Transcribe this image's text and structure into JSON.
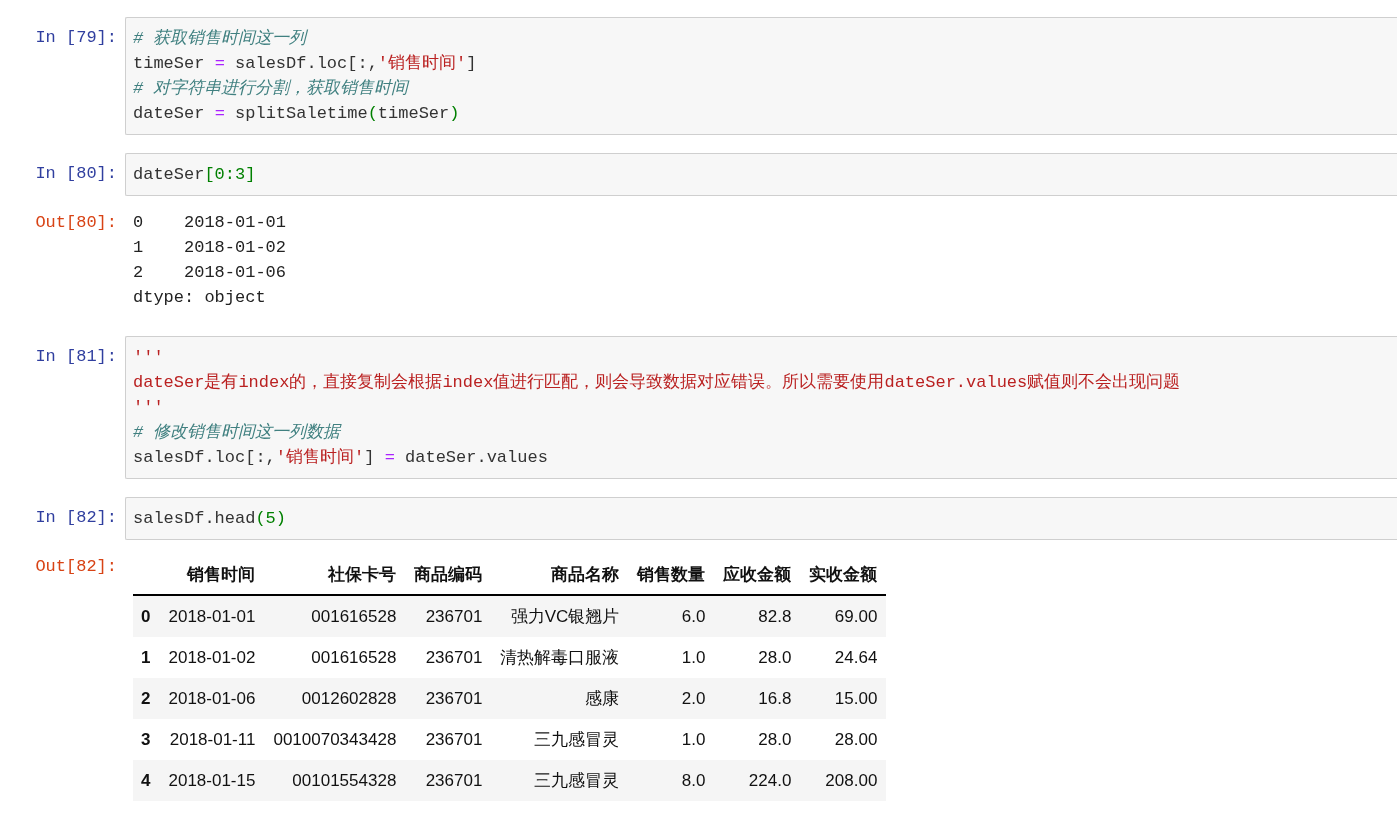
{
  "cells": [
    {
      "prompt": "In [79]:",
      "kind": "code",
      "lines": [
        [
          {
            "kind": "comment",
            "text": "# 获取销售时间这一列"
          }
        ],
        [
          {
            "kind": "name",
            "text": "timeSer "
          },
          {
            "kind": "op",
            "text": "="
          },
          {
            "kind": "name",
            "text": " salesDf.loc[:,"
          },
          {
            "kind": "string",
            "text": "'销售时间'"
          },
          {
            "kind": "name",
            "text": "]"
          }
        ],
        [
          {
            "kind": "comment",
            "text": "# 对字符串进行分割，获取销售时间"
          }
        ],
        [
          {
            "kind": "name",
            "text": "dateSer "
          },
          {
            "kind": "op",
            "text": "="
          },
          {
            "kind": "name",
            "text": " splitSaletime"
          },
          {
            "kind": "paren",
            "text": "("
          },
          {
            "kind": "name",
            "text": "timeSer"
          },
          {
            "kind": "paren",
            "text": ")"
          }
        ]
      ]
    },
    {
      "prompt": "In [80]:",
      "kind": "code",
      "lines": [
        [
          {
            "kind": "name",
            "text": "dateSer"
          },
          {
            "kind": "paren",
            "text": "[0:3]"
          }
        ]
      ]
    },
    {
      "prompt": "Out[80]:",
      "kind": "text",
      "lines": [
        "0    2018-01-01",
        "1    2018-01-02",
        "2    2018-01-06",
        "dtype: object"
      ]
    },
    {
      "prompt": "In [81]:",
      "kind": "code",
      "lines": [
        [
          {
            "kind": "string",
            "text": "'''"
          }
        ],
        [
          {
            "kind": "string",
            "text": "dateSer是有index的，直接复制会根据index值进行匹配，则会导致数据对应错误。所以需要使用dateSer.values赋值则不会出现问题"
          }
        ],
        [
          {
            "kind": "string",
            "text": "'''"
          }
        ],
        [
          {
            "kind": "comment",
            "text": "# 修改销售时间这一列数据"
          }
        ],
        [
          {
            "kind": "name",
            "text": "salesDf.loc[:,"
          },
          {
            "kind": "string",
            "text": "'销售时间'"
          },
          {
            "kind": "name",
            "text": "] "
          },
          {
            "kind": "op",
            "text": "="
          },
          {
            "kind": "name",
            "text": " dateSer.values"
          }
        ]
      ]
    },
    {
      "prompt": "In [82]:",
      "kind": "code",
      "lines": [
        [
          {
            "kind": "name",
            "text": "salesDf.head"
          },
          {
            "kind": "paren",
            "text": "(5)"
          }
        ]
      ]
    },
    {
      "prompt": "Out[82]:",
      "kind": "table",
      "columns": [
        "销售时间",
        "社保卡号",
        "商品编码",
        "商品名称",
        "销售数量",
        "应收金额",
        "实收金额"
      ],
      "rows": [
        {
          "index": "0",
          "cells": [
            "2018-01-01",
            "001616528",
            "236701",
            "强力VC银翘片",
            "6.0",
            "82.8",
            "69.00"
          ]
        },
        {
          "index": "1",
          "cells": [
            "2018-01-02",
            "001616528",
            "236701",
            "清热解毒口服液",
            "1.0",
            "28.0",
            "24.64"
          ]
        },
        {
          "index": "2",
          "cells": [
            "2018-01-06",
            "0012602828",
            "236701",
            "感康",
            "2.0",
            "16.8",
            "15.00"
          ]
        },
        {
          "index": "3",
          "cells": [
            "2018-01-11",
            "0010070343428",
            "236701",
            "三九感冒灵",
            "1.0",
            "28.0",
            "28.00"
          ]
        },
        {
          "index": "4",
          "cells": [
            "2018-01-15",
            "00101554328",
            "236701",
            "三九感冒灵",
            "8.0",
            "224.0",
            "208.00"
          ]
        }
      ]
    }
  ]
}
